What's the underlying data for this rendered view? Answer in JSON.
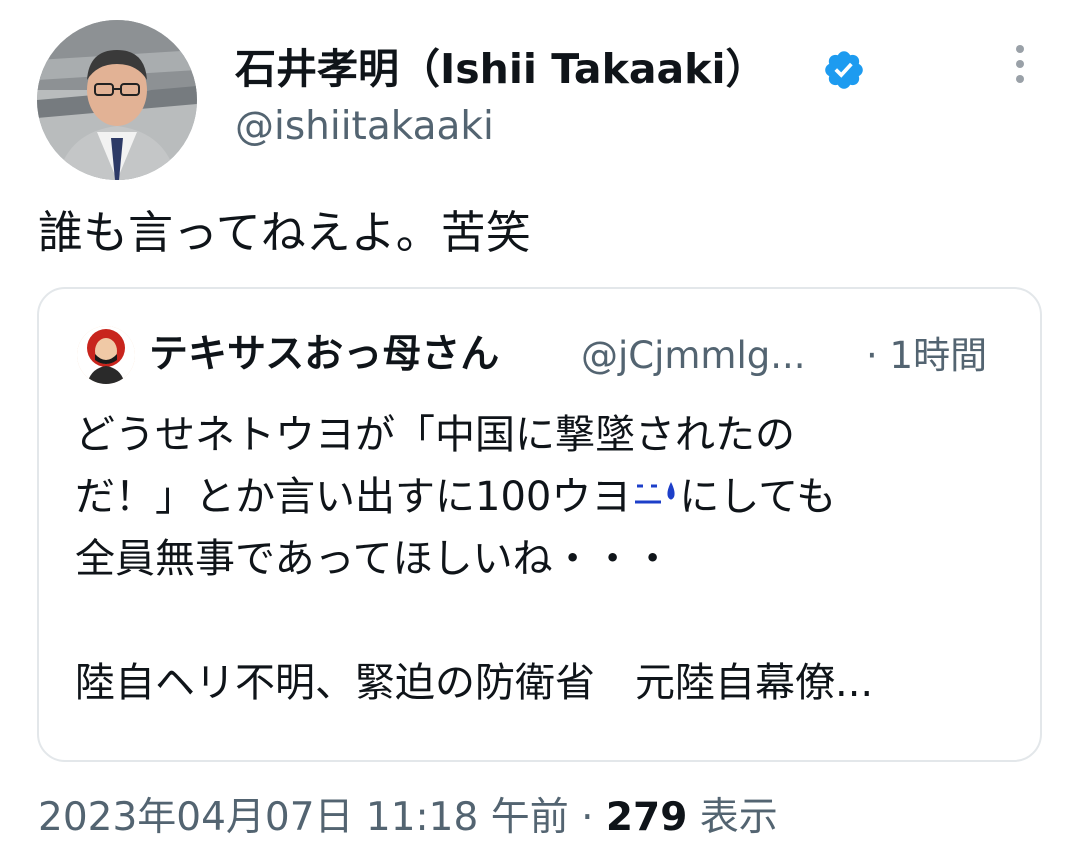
{
  "author": {
    "display_name": "石井孝明（Ishii Takaaki）",
    "handle": "@ishiitakaaki",
    "verified": true,
    "verified_color": "#1d9bf0"
  },
  "tweet": {
    "text": "誰も言ってねえよ。苦笑",
    "timestamp": "2023年04月07日 11:18 午前",
    "separator": "·",
    "views_count": "279",
    "views_label": "表示"
  },
  "quote": {
    "display_name": "テキサスおっ母さん",
    "handle": "@jCjmmlg...",
    "time": "· 1時間",
    "lines": [
      "どうせネトウヨが「中国に撃墜されたの",
      "だ！」とか言い出すに100ウヨ",
      "にしても",
      "全員無事であってほしいね・・・"
    ],
    "link_title": "陸自ヘリ不明、緊迫の防衛省　元陸自幕僚..."
  },
  "icons": {
    "verified": "verified-badge-icon",
    "more": "more-options-icon",
    "emoji": "sweat-smile-emoji-icon"
  }
}
